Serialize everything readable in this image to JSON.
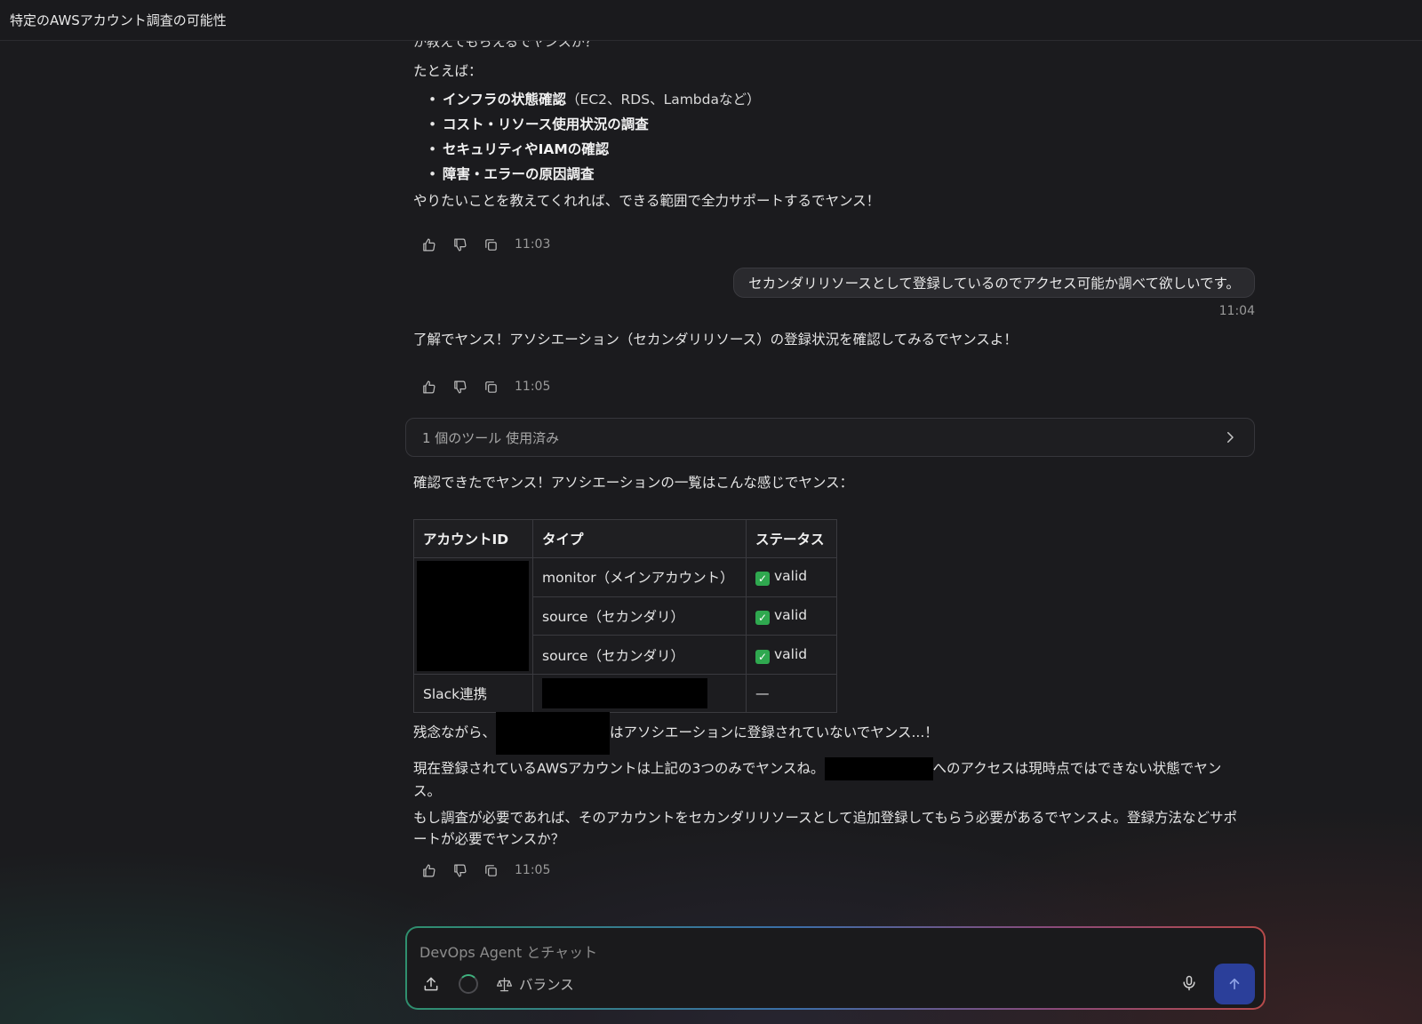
{
  "header": {
    "title": "特定のAWSアカウント調査の可能性"
  },
  "messages": {
    "clipped_line": "か教えてもらえるでヤンスか？",
    "example_intro": "たとえば：",
    "bullets": [
      {
        "bold": "インフラの状態確認",
        "rest": "（EC2、RDS、Lambdaなど）"
      },
      {
        "bold": "コスト・リソース使用状況の調査",
        "rest": ""
      },
      {
        "bold": "セキュリティやIAMの確認",
        "rest": ""
      },
      {
        "bold": "障害・エラーの原因調査",
        "rest": ""
      }
    ],
    "support_line": "やりたいことを教えてくれれば、できる範囲で全力サポートするでヤンス！",
    "time1": "11:03",
    "user_message": "セカンダリリソースとして登録しているのでアクセス可能か調べて欲しいです。",
    "user_time": "11:04",
    "reply2": "了解でヤンス！アソシエーション（セカンダリリソース）の登録状況を確認してみるでヤンスよ！",
    "time2": "11:05",
    "tool_usage": "1 個のツール 使用済み",
    "reply3_intro": "確認できたでヤンス！アソシエーションの一覧はこんな感じでヤンス：",
    "table": {
      "headers": [
        "アカウントID",
        "タイプ",
        "ステータス"
      ],
      "rows": [
        {
          "type": "monitor（メインアカウント）",
          "status": "valid"
        },
        {
          "type": "source（セカンダリ）",
          "status": "valid"
        },
        {
          "type": "source（セカンダリ）",
          "status": "valid"
        }
      ],
      "slack_row": {
        "label": "Slack連携",
        "status": "—"
      }
    },
    "unfortunate_prefix": "残念ながら、",
    "unfortunate_suffix": "はアソシエーションに登録されていないでヤンス...！",
    "current_prefix": "現在登録されているAWSアカウントは上記の3つのみでヤンスね。",
    "current_suffix": "へのアクセスは現時点ではできない状態でヤンス。",
    "need_line": "もし調査が必要であれば、そのアカウントをセカンダリリソースとして追加登録してもらう必要があるでヤンスよ。登録方法などサポートが必要でヤンスか？",
    "time3": "11:05"
  },
  "composer": {
    "placeholder": "DevOps Agent とチャット",
    "mode_label": "バランス"
  },
  "colors": {
    "background": "#1b1b1e",
    "send_button": "#2b3f9a",
    "valid_check": "#2fa84f"
  }
}
